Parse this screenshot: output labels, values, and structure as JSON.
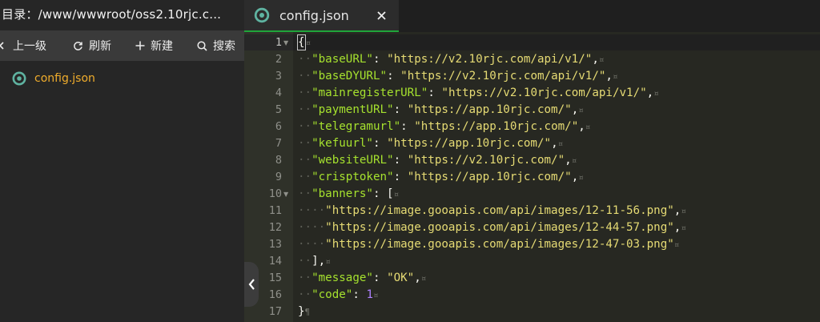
{
  "sidebar": {
    "path": "目录：/www/wwwroot/oss2.10rjc.c...",
    "toolbar": {
      "up": "上一级",
      "refresh": "刷新",
      "new": "新建",
      "search": "搜索"
    },
    "files": [
      {
        "name": "config.json",
        "icon": "json-file-icon"
      }
    ]
  },
  "tab": {
    "label": "config.json"
  },
  "editor": {
    "line_numbers": [
      "1",
      "2",
      "3",
      "4",
      "5",
      "6",
      "7",
      "8",
      "9",
      "10",
      "11",
      "12",
      "13",
      "14",
      "15",
      "16",
      "17"
    ],
    "fold_lines": [
      "1",
      "10"
    ],
    "lines": [
      [
        {
          "t": "p",
          "v": "{"
        },
        {
          "t": "inv",
          "v": "¤"
        }
      ],
      [
        {
          "t": "ws",
          "v": "··"
        },
        {
          "t": "k",
          "v": "\"baseURL\""
        },
        {
          "t": "p",
          "v": ": "
        },
        {
          "t": "s",
          "v": "\"https://v2.10rjc.com/api/v1/\""
        },
        {
          "t": "p",
          "v": ","
        },
        {
          "t": "inv",
          "v": "¤"
        }
      ],
      [
        {
          "t": "ws",
          "v": "··"
        },
        {
          "t": "k",
          "v": "\"baseDYURL\""
        },
        {
          "t": "p",
          "v": ": "
        },
        {
          "t": "s",
          "v": "\"https://v2.10rjc.com/api/v1/\""
        },
        {
          "t": "p",
          "v": ","
        },
        {
          "t": "inv",
          "v": "¤"
        }
      ],
      [
        {
          "t": "ws",
          "v": "··"
        },
        {
          "t": "k",
          "v": "\"mainregisterURL\""
        },
        {
          "t": "p",
          "v": ": "
        },
        {
          "t": "s",
          "v": "\"https://v2.10rjc.com/api/v1/\""
        },
        {
          "t": "p",
          "v": ","
        },
        {
          "t": "inv",
          "v": "¤"
        }
      ],
      [
        {
          "t": "ws",
          "v": "··"
        },
        {
          "t": "k",
          "v": "\"paymentURL\""
        },
        {
          "t": "p",
          "v": ": "
        },
        {
          "t": "s",
          "v": "\"https://app.10rjc.com/\""
        },
        {
          "t": "p",
          "v": ","
        },
        {
          "t": "inv",
          "v": "¤"
        }
      ],
      [
        {
          "t": "ws",
          "v": "··"
        },
        {
          "t": "k",
          "v": "\"telegramurl\""
        },
        {
          "t": "p",
          "v": ": "
        },
        {
          "t": "s",
          "v": "\"https://app.10rjc.com/\""
        },
        {
          "t": "p",
          "v": ","
        },
        {
          "t": "inv",
          "v": "¤"
        }
      ],
      [
        {
          "t": "ws",
          "v": "··"
        },
        {
          "t": "k",
          "v": "\"kefuurl\""
        },
        {
          "t": "p",
          "v": ": "
        },
        {
          "t": "s",
          "v": "\"https://app.10rjc.com/\""
        },
        {
          "t": "p",
          "v": ","
        },
        {
          "t": "inv",
          "v": "¤"
        }
      ],
      [
        {
          "t": "ws",
          "v": "··"
        },
        {
          "t": "k",
          "v": "\"websiteURL\""
        },
        {
          "t": "p",
          "v": ": "
        },
        {
          "t": "s",
          "v": "\"https://v2.10rjc.com/\""
        },
        {
          "t": "p",
          "v": ","
        },
        {
          "t": "inv",
          "v": "¤"
        }
      ],
      [
        {
          "t": "ws",
          "v": "··"
        },
        {
          "t": "k",
          "v": "\"crisptoken\""
        },
        {
          "t": "p",
          "v": ": "
        },
        {
          "t": "s",
          "v": "\"https://app.10rjc.com/\""
        },
        {
          "t": "p",
          "v": ","
        },
        {
          "t": "inv",
          "v": "¤"
        }
      ],
      [
        {
          "t": "ws",
          "v": "··"
        },
        {
          "t": "k",
          "v": "\"banners\""
        },
        {
          "t": "p",
          "v": ": ["
        },
        {
          "t": "inv",
          "v": "¤"
        }
      ],
      [
        {
          "t": "ws",
          "v": "····"
        },
        {
          "t": "s",
          "v": "\"https://image.gooapis.com/api/images/12-11-56.png\""
        },
        {
          "t": "p",
          "v": ","
        },
        {
          "t": "inv",
          "v": "¤"
        }
      ],
      [
        {
          "t": "ws",
          "v": "····"
        },
        {
          "t": "s",
          "v": "\"https://image.gooapis.com/api/images/12-44-57.png\""
        },
        {
          "t": "p",
          "v": ","
        },
        {
          "t": "inv",
          "v": "¤"
        }
      ],
      [
        {
          "t": "ws",
          "v": "····"
        },
        {
          "t": "s",
          "v": "\"https://image.gooapis.com/api/images/12-47-03.png\""
        },
        {
          "t": "inv",
          "v": "¤"
        }
      ],
      [
        {
          "t": "ws",
          "v": "··"
        },
        {
          "t": "p",
          "v": "],"
        },
        {
          "t": "inv",
          "v": "¤"
        }
      ],
      [
        {
          "t": "ws",
          "v": "··"
        },
        {
          "t": "k",
          "v": "\"message\""
        },
        {
          "t": "p",
          "v": ": "
        },
        {
          "t": "s",
          "v": "\"OK\""
        },
        {
          "t": "p",
          "v": ","
        },
        {
          "t": "inv",
          "v": "¤"
        }
      ],
      [
        {
          "t": "ws",
          "v": "··"
        },
        {
          "t": "k",
          "v": "\"code\""
        },
        {
          "t": "p",
          "v": ": "
        },
        {
          "t": "n",
          "v": "1"
        },
        {
          "t": "inv",
          "v": "¤"
        }
      ],
      [
        {
          "t": "p",
          "v": "}"
        },
        {
          "t": "inv",
          "v": "¶"
        }
      ]
    ]
  },
  "colors": {
    "accent": "#20a53a",
    "key": "#a6e22e",
    "string": "#e6db74",
    "number": "#ae81ff",
    "file_name": "#f0ad2c"
  }
}
